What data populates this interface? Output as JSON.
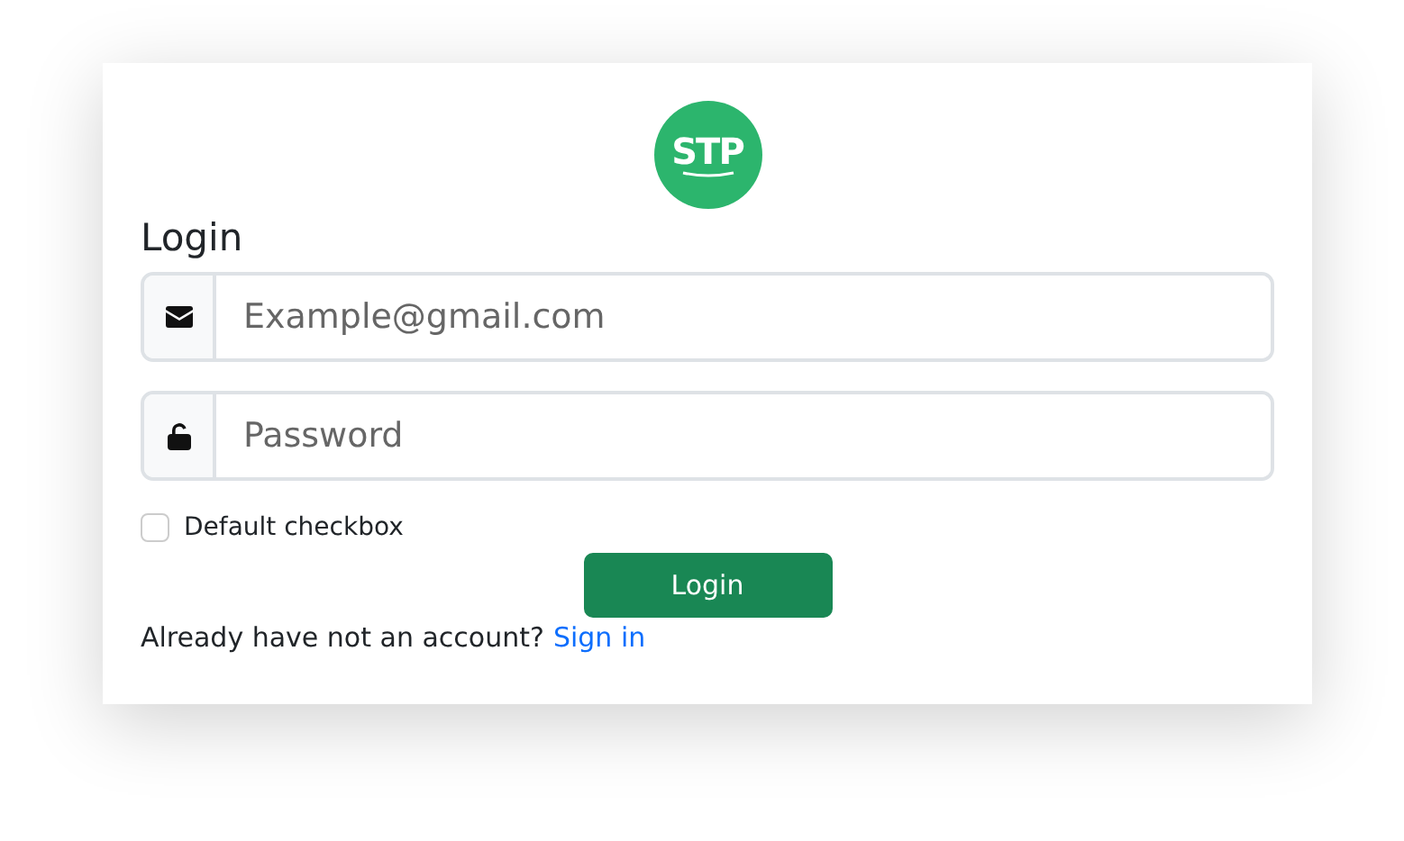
{
  "logo": {
    "text": "STP"
  },
  "title": "Login",
  "fields": [
    {
      "kind": "email",
      "placeholder": "Example@gmail.com"
    },
    {
      "kind": "password",
      "placeholder": "Password"
    }
  ],
  "checkbox": {
    "label": "Default checkbox",
    "checked": false
  },
  "button": "Login",
  "footer": {
    "text": "Already have not an account?",
    "link": "Sign in"
  }
}
